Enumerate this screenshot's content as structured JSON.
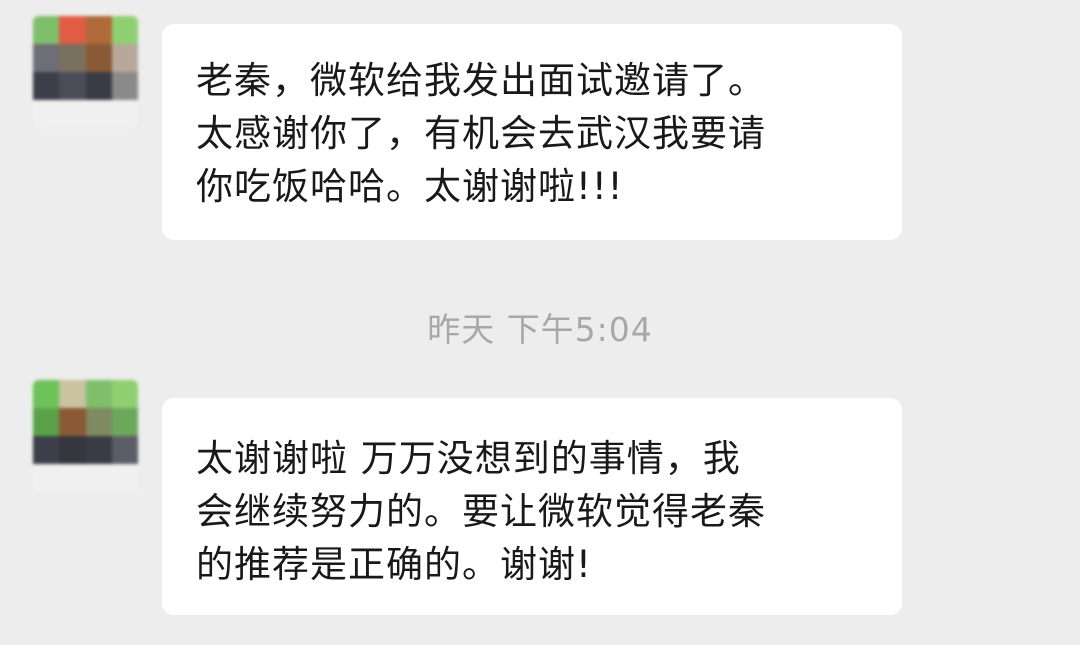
{
  "messages": [
    {
      "lines": [
        "老秦，微软给我发出面试邀请了。",
        "太感谢你了，有机会去武汉我要请",
        "你吃饭哈哈。太谢谢啦!!!"
      ]
    },
    {
      "lines": [
        "太谢谢啦 万万没想到的事情，我",
        "会继续努力的。要让微软觉得老秦",
        "的推荐是正确的。谢谢!"
      ]
    }
  ],
  "timestamp": "昨天 下午5:04",
  "avatars": [
    {
      "mosaic_colors": [
        "#7fbf6a",
        "#e05c44",
        "#b06a3a",
        "#8fcf72",
        "#6e6e76",
        "#7a7060",
        "#8a5a36",
        "#b8a89a",
        "#3c3f4a",
        "#4a4d58",
        "#3a3b44",
        "#8a8a8a",
        "#f0f0f0",
        "#f0f0f0",
        "#f0f0f0",
        "#f0f0f0"
      ]
    },
    {
      "mosaic_colors": [
        "#6ec25a",
        "#c9c3a0",
        "#7fbf6a",
        "#8fcf72",
        "#5aa24a",
        "#8a5a36",
        "#7f8a62",
        "#6ca85a",
        "#3c3f4a",
        "#35363e",
        "#3a3b44",
        "#5c5d66",
        "#f0f0f0",
        "#f0f0f0",
        "#f0f0f0",
        "#f0f0f0"
      ]
    }
  ]
}
